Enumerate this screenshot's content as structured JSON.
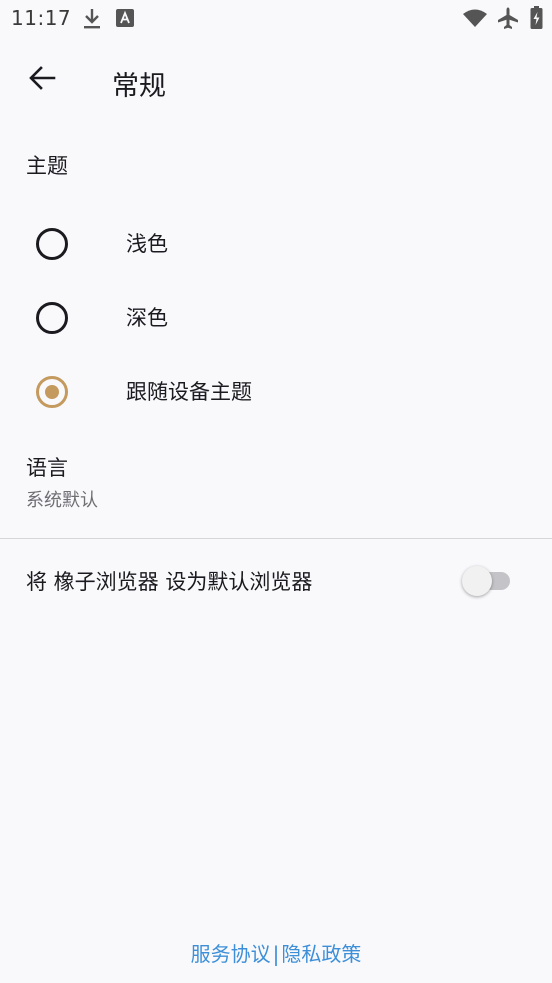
{
  "status_bar": {
    "time": "11:17",
    "icons": [
      "download-icon",
      "a-notification-icon",
      "wifi-icon",
      "airplane-mode-icon",
      "battery-charging-icon"
    ]
  },
  "app_bar": {
    "back_icon": "arrow-left-icon",
    "title": "常规"
  },
  "theme_section": {
    "title": "主题",
    "options": [
      {
        "label": "浅色",
        "selected": false
      },
      {
        "label": "深色",
        "selected": false
      },
      {
        "label": "跟随设备主题",
        "selected": true
      }
    ]
  },
  "language": {
    "title": "语言",
    "value": "系统默认"
  },
  "default_browser": {
    "label": "将 橡子浏览器 设为默认浏览器",
    "enabled": false
  },
  "footer": {
    "terms": "服务协议",
    "separator": "|",
    "privacy": "隐私政策"
  },
  "colors": {
    "accent": "#c49a5e",
    "link": "#3d8fd8",
    "background": "#f9f9fc"
  }
}
